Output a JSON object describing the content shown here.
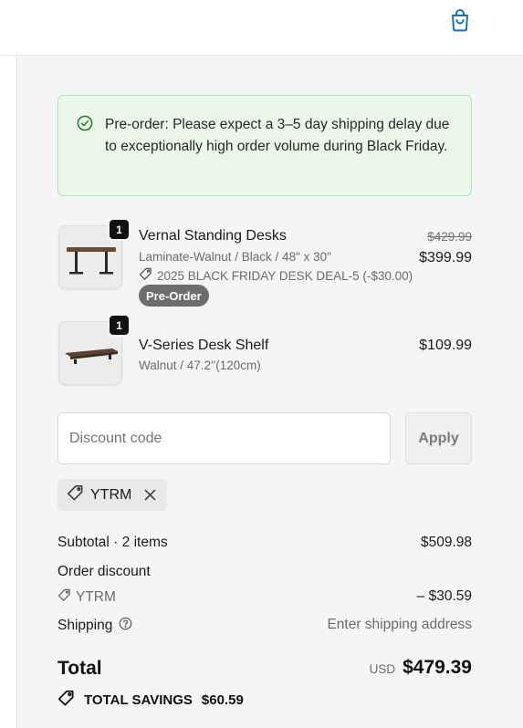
{
  "header": {
    "cart_icon": "shopping-bag-icon",
    "accent_color": "#1773b0"
  },
  "banner": {
    "icon": "check-circle-icon",
    "text": "Pre-order: Please expect a 3–5 day shipping delay due to exceptionally high order volume during Black Friday."
  },
  "items": [
    {
      "quantity": "1",
      "name": "Vernal Standing Desks",
      "variant": "Laminate-Walnut / Black / 48\" x 30\"",
      "discount": "2025 BLACK FRIDAY DESK DEAL-5 (-$30.00)",
      "badge": "Pre-Order",
      "original_price": "$429.99",
      "price": "$399.99"
    },
    {
      "quantity": "1",
      "name": "V-Series Desk Shelf",
      "variant": "Walnut / 47.2''(120cm)",
      "price": "$109.99"
    }
  ],
  "discount": {
    "placeholder": "Discount code",
    "apply_label": "Apply",
    "applied_code": "YTRM"
  },
  "summary": {
    "subtotal_label": "Subtotal · 2 items",
    "subtotal_value": "$509.98",
    "order_discount_label": "Order discount",
    "order_discount_code": "YTRM",
    "order_discount_value": "– $30.59",
    "shipping_label": "Shipping",
    "shipping_value": "Enter shipping address",
    "total_label": "Total",
    "currency": "USD",
    "total_value": "$479.39",
    "savings_label": "TOTAL SAVINGS",
    "savings_value": "$60.59"
  }
}
